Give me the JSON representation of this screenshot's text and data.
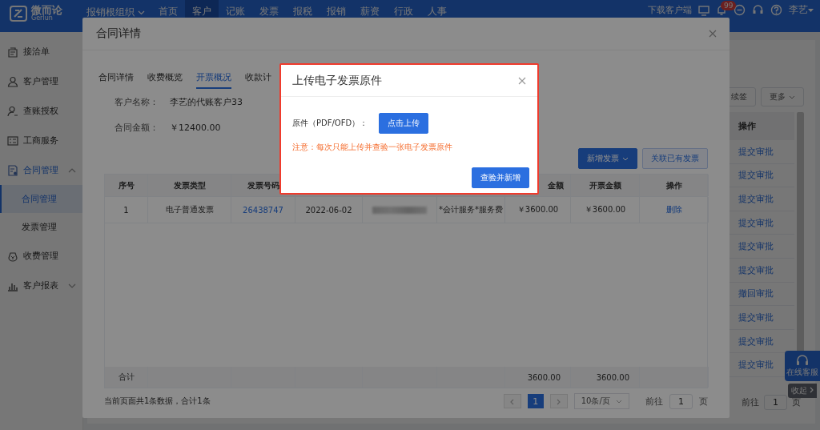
{
  "top_bar": {
    "logo": {
      "name": "微而论",
      "sub": "Gerlun"
    },
    "org": "报销根组织",
    "nav": [
      {
        "label": "首页",
        "selected": false
      },
      {
        "label": "客户",
        "selected": true
      },
      {
        "label": "记账",
        "selected": false
      },
      {
        "label": "发票",
        "selected": false
      },
      {
        "label": "报税",
        "selected": false
      },
      {
        "label": "报销",
        "selected": false
      },
      {
        "label": "薪资",
        "selected": false
      },
      {
        "label": "行政",
        "selected": false
      },
      {
        "label": "人事",
        "selected": false
      }
    ],
    "download": "下载客户端",
    "notification_badge": "99",
    "user": "李艺"
  },
  "sidebar": {
    "items": [
      {
        "label": "接洽单"
      },
      {
        "label": "客户管理"
      },
      {
        "label": "查账授权"
      },
      {
        "label": "工商服务"
      },
      {
        "label": "合同管理",
        "expanded": true,
        "children": [
          {
            "label": "合同管理",
            "selected": true
          },
          {
            "label": "发票管理",
            "selected": false
          }
        ]
      },
      {
        "label": "收费管理"
      },
      {
        "label": "客户报表",
        "expanded": false
      }
    ]
  },
  "page": {
    "toolbar": [
      {
        "label": "续签",
        "kind": "plain"
      },
      {
        "label": "更多",
        "kind": "dropdown"
      }
    ],
    "table": {
      "columns": [
        "操作"
      ],
      "rows": [
        {
          "action": "提交审批"
        },
        {
          "action": "提交审批"
        },
        {
          "action": "提交审批"
        },
        {
          "action": "提交审批"
        },
        {
          "action": "提交审批"
        },
        {
          "action": "提交审批"
        },
        {
          "action": "撤回审批"
        },
        {
          "action": "提交审批"
        },
        {
          "action": "提交审批"
        },
        {
          "action": "提交审批"
        }
      ]
    },
    "pagination": {
      "goto_label": "前往",
      "page": "1",
      "unit": "页"
    }
  },
  "support_widget": {
    "label": "在线客服",
    "collapse": "收起"
  },
  "contract_dialog": {
    "title": "合同详情",
    "tabs": [
      {
        "label": "合同详情",
        "selected": false
      },
      {
        "label": "收费概览",
        "selected": false
      },
      {
        "label": "开票概况",
        "selected": true
      },
      {
        "label": "收款计",
        "selected": false
      }
    ],
    "fields": [
      {
        "label": "客户名称：",
        "value": "李艺的代账客户33"
      },
      {
        "label": "合同金额：",
        "value": "￥12400.00"
      }
    ],
    "buttons": [
      {
        "label": "新增发票",
        "kind": "primary-dropdown"
      },
      {
        "label": "关联已有发票",
        "kind": "plain"
      }
    ],
    "table": {
      "columns": [
        {
          "header": "序号"
        },
        {
          "header": "发票类型"
        },
        {
          "header": "发票号码"
        },
        {},
        {},
        {},
        {
          "header": "金额"
        },
        {
          "header": "开票金额"
        },
        {
          "header": "操作"
        }
      ],
      "rows": [
        {
          "cells": [
            {
              "kind": "text",
              "text": "1"
            },
            {
              "kind": "text",
              "text": "电子普通发票"
            },
            {
              "kind": "link",
              "text": "26438747"
            },
            {
              "kind": "text",
              "text": "2022-06-02"
            },
            {
              "kind": "redacted"
            },
            {
              "kind": "text",
              "text": "*会计服务*服务费"
            },
            {
              "kind": "text",
              "text": "￥3600.00"
            },
            {
              "kind": "text",
              "text": "￥3600.00"
            },
            {
              "kind": "link",
              "text": "删除"
            }
          ]
        }
      ],
      "footer": {
        "label": "合计",
        "amount": "3600.00",
        "invoiced_amount": "3600.00"
      }
    },
    "pagination": {
      "summary": "当前页面共1条数据，合计1条",
      "page": "1",
      "page_size": "10条/页",
      "goto_label": "前往",
      "goto_value": "1",
      "unit": "页"
    }
  },
  "upload_dialog": {
    "title": "上传电子发票原件",
    "field_label": "原件（PDF/OFD）：",
    "upload_button": "点击上传",
    "notice": "注意：每次只能上传并查验一张电子发票原件",
    "submit_button": "查验并新增"
  }
}
